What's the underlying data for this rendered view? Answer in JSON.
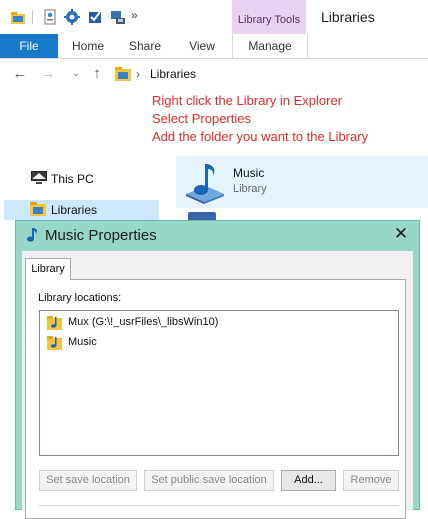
{
  "window": {
    "title": "Libraries",
    "context_tab_group": "Library Tools"
  },
  "ribbon": {
    "tabs": [
      "File",
      "Home",
      "Share",
      "View",
      "Manage"
    ]
  },
  "address": {
    "path": "Libraries"
  },
  "annotations": [
    "Right click the Library in Explorer",
    "Select Properties",
    "Add the folder you want to the Library"
  ],
  "nav_pane": {
    "items": [
      "This PC",
      "Libraries"
    ]
  },
  "content": {
    "item_name": "Music",
    "item_type": "Library"
  },
  "dialog": {
    "title": "Music Properties",
    "close_glyph": "✕",
    "tab": "Library",
    "locations_label": "Library locations:",
    "locations": [
      "Mux (G:\\!_usrFiles\\_libsWin10)",
      "Music"
    ],
    "buttons": {
      "set_save": "Set save location",
      "set_public_save": "Set public save location",
      "add": "Add...",
      "remove": "Remove"
    }
  },
  "colors": {
    "accent": "#1979ca",
    "annotation": "#e12b2b",
    "dialog_frame": "#96d7c8",
    "context_tab": "#e7d3f0"
  }
}
